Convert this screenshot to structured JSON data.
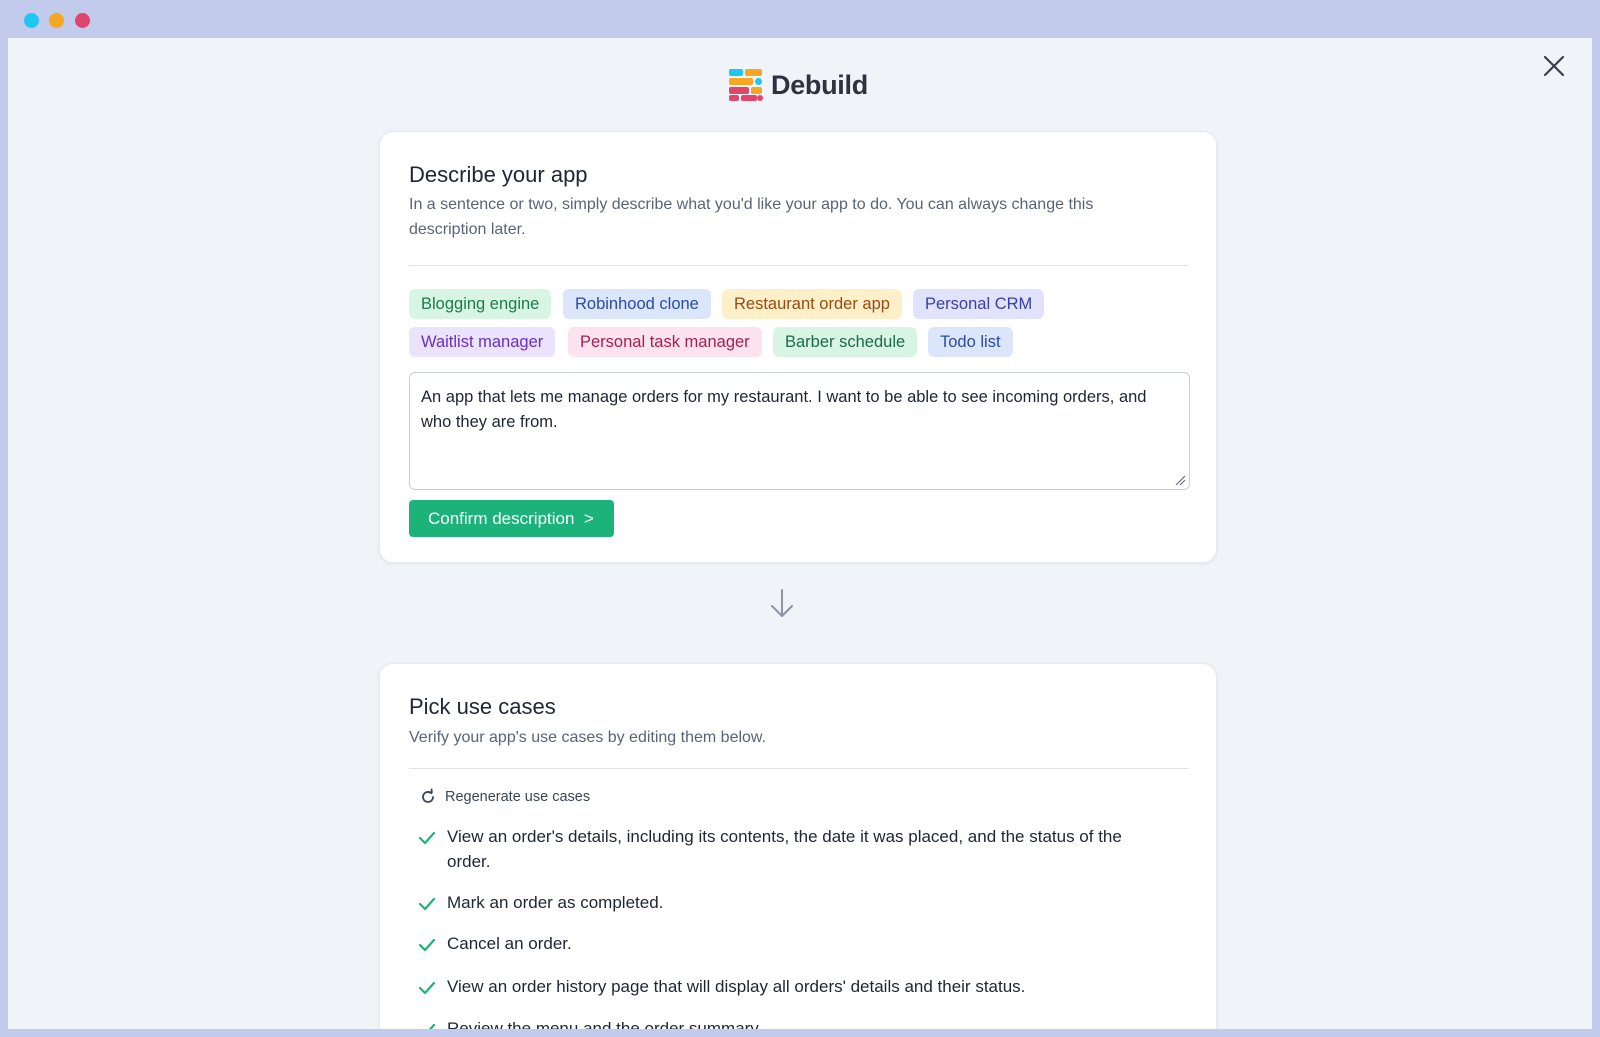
{
  "brand": {
    "name": "Debuild"
  },
  "describe": {
    "title": "Describe your app",
    "subtitle": "In a sentence or two, simply describe what you'd like your app to do. You can always change this description later.",
    "chips": [
      {
        "label": "Blogging engine",
        "bg": "#d8f5e4",
        "fg": "#1d7a4a"
      },
      {
        "label": "Robinhood clone",
        "bg": "#dbe6fb",
        "fg": "#2a4aa6"
      },
      {
        "label": "Restaurant order app",
        "bg": "#fdf0c8",
        "fg": "#9a4a12"
      },
      {
        "label": "Personal CRM",
        "bg": "#e0e3fb",
        "fg": "#3a3ea8"
      },
      {
        "label": "Waitlist manager",
        "bg": "#ebe3fb",
        "fg": "#6a2fc0"
      },
      {
        "label": "Personal task manager",
        "bg": "#fde3ee",
        "fg": "#a8204f"
      },
      {
        "label": "Barber schedule",
        "bg": "#d8f5e4",
        "fg": "#1d6a46"
      },
      {
        "label": "Todo list",
        "bg": "#dbe6fb",
        "fg": "#2a4aa6"
      }
    ],
    "description_value": "An app that lets me manage orders for my restaurant. I want to be able to see incoming orders, and who they are from.",
    "confirm_label": "Confirm description  >"
  },
  "use_cases": {
    "title": "Pick use cases",
    "subtitle": "Verify your app's use cases by editing them below.",
    "regenerate_label": "Regenerate use cases",
    "items": [
      "View an order's details, including its contents, the date it was placed, and the status of the order.",
      "Mark an order as completed.",
      "Cancel an order.",
      "View an order history page that will display all orders' details and their status.",
      "Review the menu and the order summary."
    ]
  },
  "colors": {
    "accent": "#1cb37a",
    "check": "#1cb37a"
  }
}
